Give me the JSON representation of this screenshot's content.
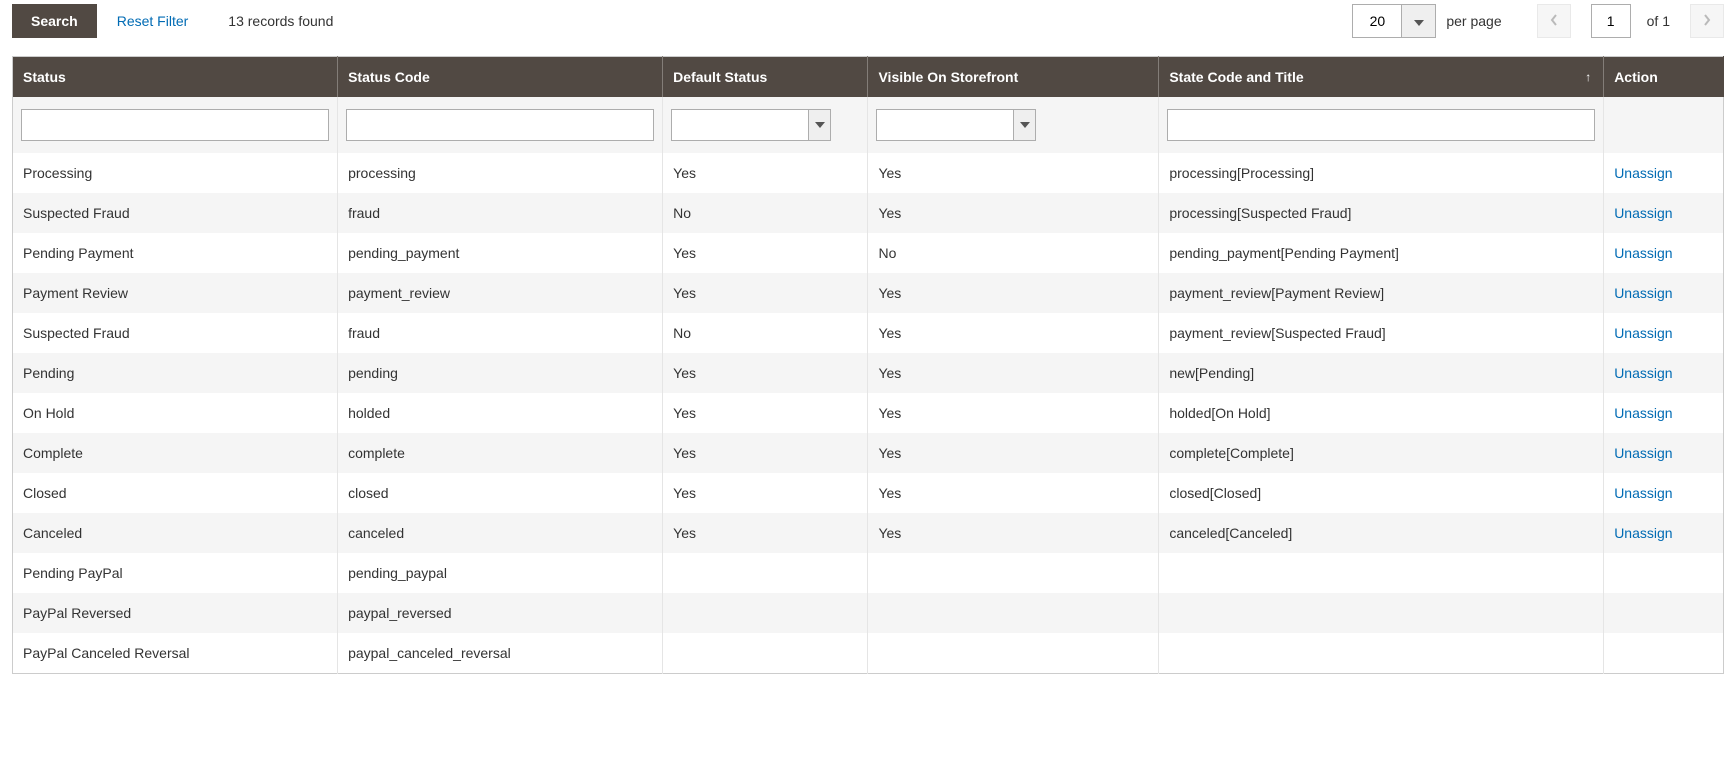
{
  "toolbar": {
    "search_label": "Search",
    "reset_label": "Reset Filter",
    "records_found": "13 records found"
  },
  "pager": {
    "page_size": "20",
    "per_page_label": "per page",
    "current_page": "1",
    "of_label": "of 1"
  },
  "columns": [
    {
      "label": "Status",
      "filter": "text"
    },
    {
      "label": "Status Code",
      "filter": "text"
    },
    {
      "label": "Default Status",
      "filter": "select"
    },
    {
      "label": "Visible On Storefront",
      "filter": "select"
    },
    {
      "label": "State Code and Title",
      "filter": "text",
      "sorted": "asc"
    },
    {
      "label": "Action",
      "filter": "none"
    }
  ],
  "action_label": "Unassign",
  "rows": [
    {
      "status": "Processing",
      "code": "processing",
      "default": "Yes",
      "visible": "Yes",
      "state": "processing[Processing]",
      "action": true
    },
    {
      "status": "Suspected Fraud",
      "code": "fraud",
      "default": "No",
      "visible": "Yes",
      "state": "processing[Suspected Fraud]",
      "action": true
    },
    {
      "status": "Pending Payment",
      "code": "pending_payment",
      "default": "Yes",
      "visible": "No",
      "state": "pending_payment[Pending Payment]",
      "action": true
    },
    {
      "status": "Payment Review",
      "code": "payment_review",
      "default": "Yes",
      "visible": "Yes",
      "state": "payment_review[Payment Review]",
      "action": true
    },
    {
      "status": "Suspected Fraud",
      "code": "fraud",
      "default": "No",
      "visible": "Yes",
      "state": "payment_review[Suspected Fraud]",
      "action": true
    },
    {
      "status": "Pending",
      "code": "pending",
      "default": "Yes",
      "visible": "Yes",
      "state": "new[Pending]",
      "action": true
    },
    {
      "status": "On Hold",
      "code": "holded",
      "default": "Yes",
      "visible": "Yes",
      "state": "holded[On Hold]",
      "action": true
    },
    {
      "status": "Complete",
      "code": "complete",
      "default": "Yes",
      "visible": "Yes",
      "state": "complete[Complete]",
      "action": true
    },
    {
      "status": "Closed",
      "code": "closed",
      "default": "Yes",
      "visible": "Yes",
      "state": "closed[Closed]",
      "action": true
    },
    {
      "status": "Canceled",
      "code": "canceled",
      "default": "Yes",
      "visible": "Yes",
      "state": "canceled[Canceled]",
      "action": true
    },
    {
      "status": "Pending PayPal",
      "code": "pending_paypal",
      "default": "",
      "visible": "",
      "state": "",
      "action": false
    },
    {
      "status": "PayPal Reversed",
      "code": "paypal_reversed",
      "default": "",
      "visible": "",
      "state": "",
      "action": false
    },
    {
      "status": "PayPal Canceled Reversal",
      "code": "paypal_canceled_reversal",
      "default": "",
      "visible": "",
      "state": "",
      "action": false
    }
  ]
}
